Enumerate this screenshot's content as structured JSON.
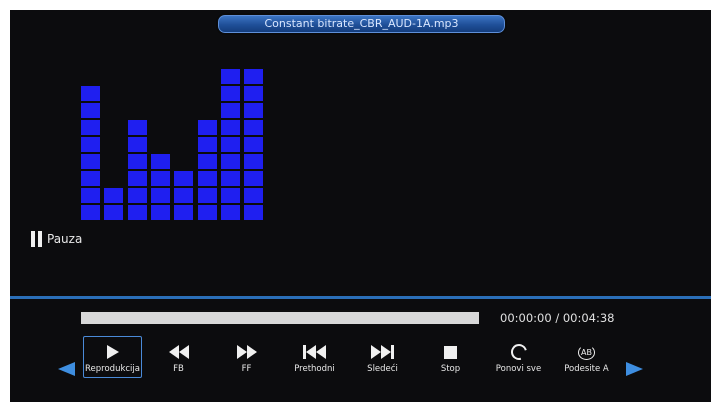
{
  "title": "Constant bitrate_CBR_AUD-1A.mp3",
  "status": {
    "label": "Pauza"
  },
  "equalizer": {
    "color": "#1f1ff0",
    "levels": [
      8,
      2,
      6,
      4,
      3,
      6,
      9,
      9
    ]
  },
  "player": {
    "progress": 0,
    "elapsed": "00:00:00",
    "separator": "/",
    "total": "00:04:38"
  },
  "controls": [
    {
      "label": "Reprodukcija",
      "icon": "play-icon",
      "active": true
    },
    {
      "label": "FB",
      "icon": "rewind-icon",
      "active": false
    },
    {
      "label": "FF",
      "icon": "fast-forward-icon",
      "active": false
    },
    {
      "label": "Prethodni",
      "icon": "skip-previous-icon",
      "active": false
    },
    {
      "label": "Sledeći",
      "icon": "skip-next-icon",
      "active": false
    },
    {
      "label": "Stop",
      "icon": "stop-icon",
      "active": false
    },
    {
      "label": "Ponovi sve",
      "icon": "repeat-icon",
      "active": false
    },
    {
      "label": "Podesite A",
      "icon": "ab-repeat-icon",
      "active": false
    }
  ],
  "colors": {
    "accent": "#3e8ee0",
    "background": "#0c0c0e"
  }
}
